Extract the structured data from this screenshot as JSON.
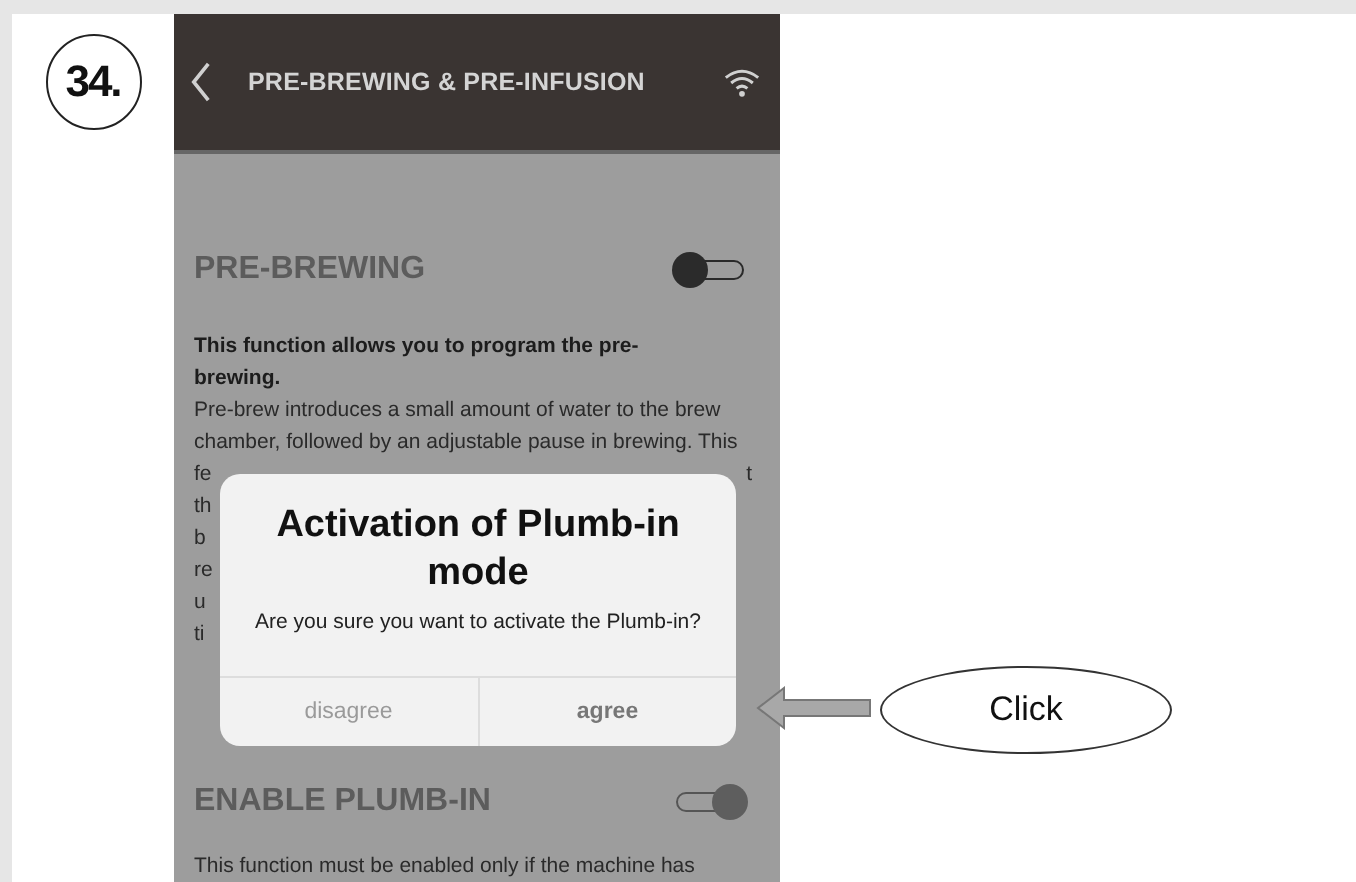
{
  "step_badge": "34.",
  "screen": {
    "header": {
      "title": "PRE-BREWING & PRE-INFUSION"
    },
    "sections": [
      {
        "heading": "PRE-BREWING",
        "on": false,
        "intro": "This function allows you to program the pre-brewing.",
        "lines": [
          {
            "left": "Pre-brew introduces a small amount of water to the brew"
          },
          {
            "left": "chamber, followed by an adjustable pause in brewing. This"
          },
          {
            "left": "fe",
            "right": "t"
          },
          {
            "left": "th"
          },
          {
            "left": "b"
          },
          {
            "left": "re"
          },
          {
            "left": "u"
          },
          {
            "left": "ti"
          }
        ]
      },
      {
        "heading": "ENABLE PLUMB-IN",
        "on": true,
        "lines": [
          {
            "left": "This function must be enabled only if the machine has"
          }
        ]
      }
    ],
    "dialog": {
      "title": "Activation of Plumb-in mode",
      "message": "Are you sure you want to activate the Plumb-in?",
      "buttons": [
        {
          "label": "disagree",
          "primary": false
        },
        {
          "label": "agree",
          "primary": true
        }
      ]
    }
  },
  "callout": {
    "label": "Click"
  }
}
